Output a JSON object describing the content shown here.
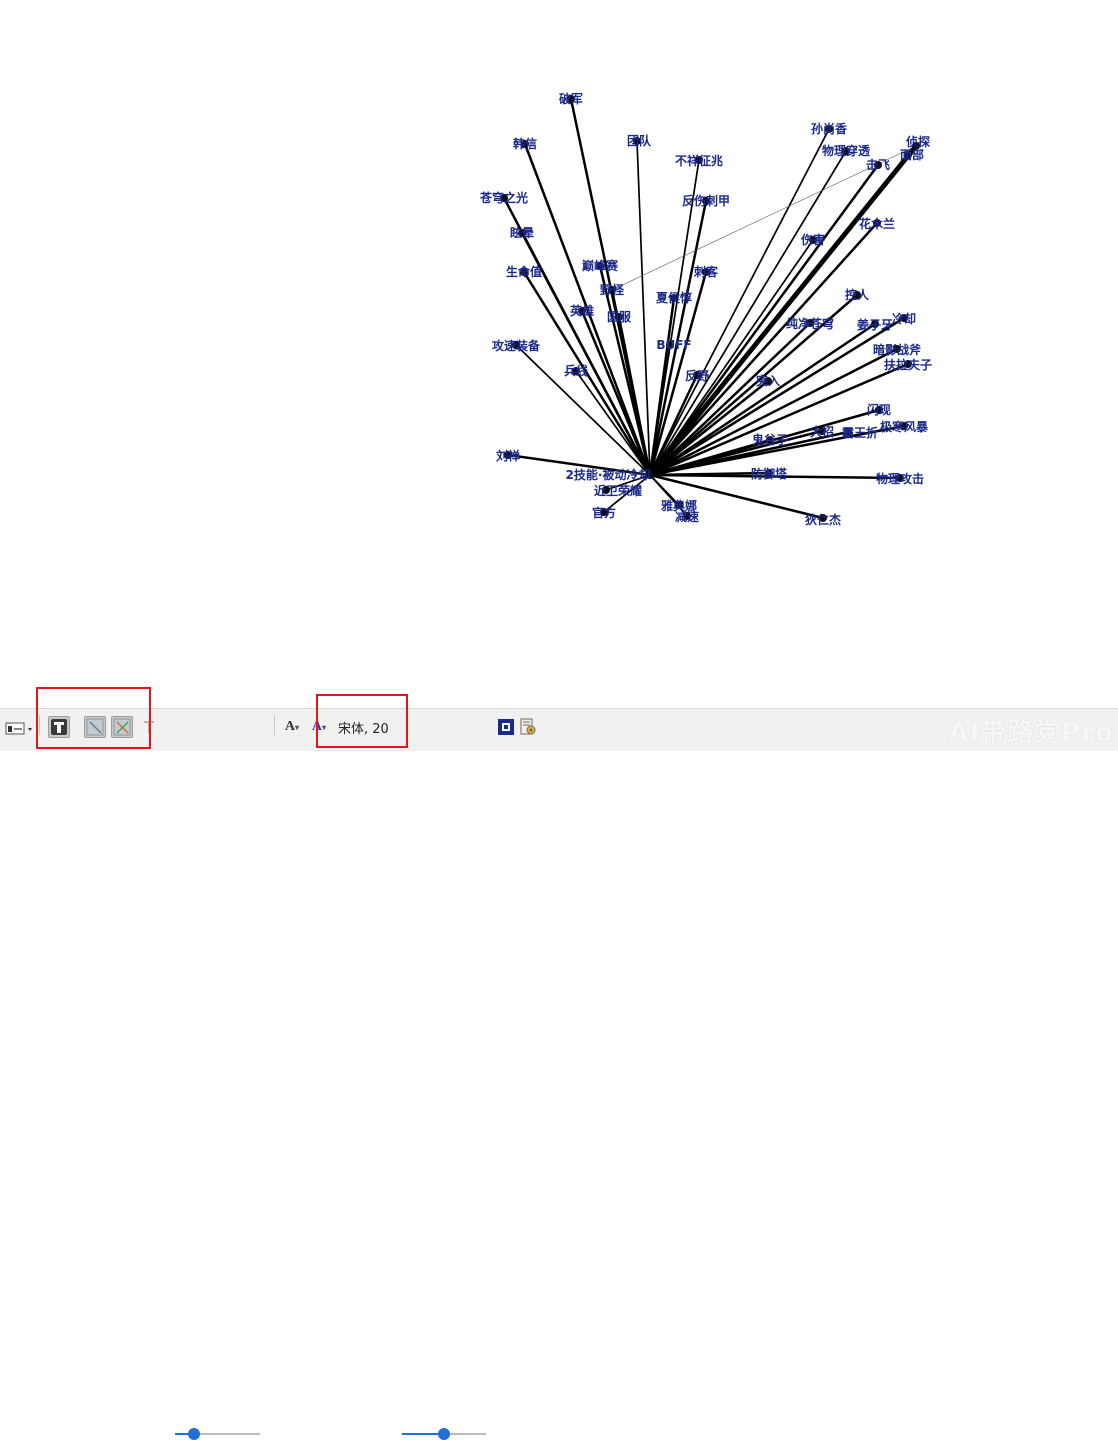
{
  "graph": {
    "hub": {
      "label": "2技能·被动冷却"
    },
    "nodes": [
      {
        "label": "破军",
        "weight": 2
      },
      {
        "label": "韩信",
        "weight": 2
      },
      {
        "label": "团队",
        "weight": 1
      },
      {
        "label": "不祥征兆",
        "weight": 1
      },
      {
        "label": "孙尚香",
        "weight": 1
      },
      {
        "label": "物理穿透",
        "weight": 1
      },
      {
        "label": "击飞",
        "weight": 2
      },
      {
        "label": "侦探",
        "weight": 5
      },
      {
        "label": "面部",
        "weight": 1
      },
      {
        "label": "苍穹之光",
        "weight": 2
      },
      {
        "label": "反伤刺甲",
        "weight": 2
      },
      {
        "label": "眩晕",
        "weight": 2
      },
      {
        "label": "花木兰",
        "weight": 2
      },
      {
        "label": "伤害",
        "weight": 1
      },
      {
        "label": "生命值",
        "weight": 2
      },
      {
        "label": "巅峰赛",
        "weight": 2
      },
      {
        "label": "刺客",
        "weight": 2
      },
      {
        "label": "野怪",
        "weight": 2
      },
      {
        "label": "夏侯惇",
        "weight": 2
      },
      {
        "label": "英雄",
        "weight": 2
      },
      {
        "label": "国服",
        "weight": 2
      },
      {
        "label": "控人",
        "weight": 2
      },
      {
        "label": "纯净苍穹",
        "weight": 2
      },
      {
        "label": "姜子牙",
        "weight": 2
      },
      {
        "label": "冷却",
        "weight": 2
      },
      {
        "label": "攻速装备",
        "weight": 1
      },
      {
        "label": "BUFF",
        "weight": 1
      },
      {
        "label": "暗影战斧",
        "weight": 2
      },
      {
        "label": "兵线",
        "weight": 1
      },
      {
        "label": "反野",
        "weight": 2
      },
      {
        "label": "扶拉夫子",
        "weight": 2
      },
      {
        "label": "突入",
        "weight": 2
      },
      {
        "label": "闪现",
        "weight": 2
      },
      {
        "label": "极寒风暴",
        "weight": 2
      },
      {
        "label": "大招",
        "weight": 2
      },
      {
        "label": "霸王折",
        "weight": 2
      },
      {
        "label": "鬼谷子",
        "weight": 2
      },
      {
        "label": "刘禅",
        "weight": 2
      },
      {
        "label": "防御塔",
        "weight": 2
      },
      {
        "label": "物理攻击",
        "weight": 2
      },
      {
        "label": "近卫荣耀",
        "weight": 1
      },
      {
        "label": "官方",
        "weight": 1
      },
      {
        "label": "雅典娜",
        "weight": 1
      },
      {
        "label": "减速",
        "weight": 1
      },
      {
        "label": "狄仁杰",
        "weight": 2
      }
    ],
    "cross_links": [
      [
        "侦探",
        "野怪"
      ]
    ]
  },
  "toolbar": {
    "items": [
      {
        "name": "layout-dropdown-icon",
        "pressed": false
      },
      {
        "name": "text-icon",
        "pressed": true
      },
      {
        "name": "edge-style-icon",
        "pressed": true
      },
      {
        "name": "edge-color-icon",
        "pressed": true
      },
      {
        "name": "text-format-icon",
        "pressed": false
      }
    ],
    "label_size_slider": 0.22,
    "font_size_decrease_icon": "A",
    "font_size_increase_icon": "A",
    "font_label": "宋体, 20",
    "font_slider": 0.5,
    "accent_color": "#1f6fd6",
    "highlight_color": "#e8141b"
  },
  "watermark": "AI带路党Pro"
}
